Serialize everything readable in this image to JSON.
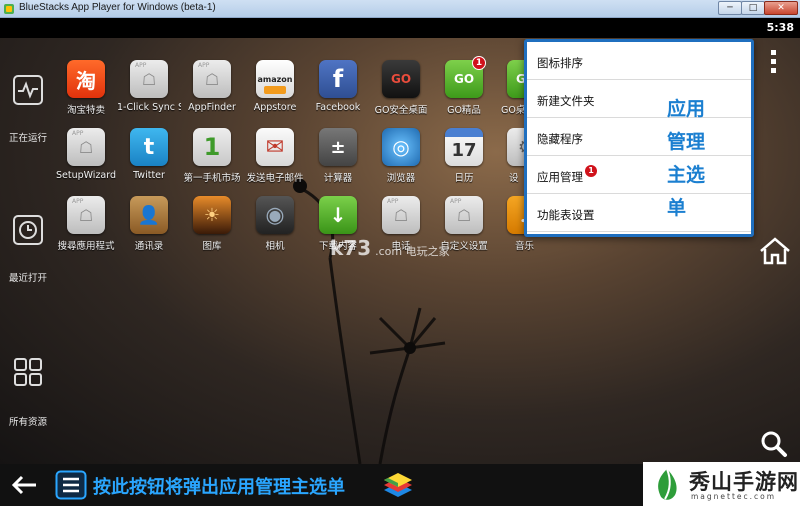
{
  "window": {
    "title": "BlueStacks App Player for Windows (beta-1)",
    "min_label": "─",
    "max_label": "□",
    "close_label": "✕"
  },
  "status": {
    "time": "5:38"
  },
  "rail": {
    "running_label": "正在运行",
    "recent_label": "最近打开",
    "all_label": "所有资源"
  },
  "apps": {
    "row1": [
      {
        "label": "淘宝特卖",
        "glyph": "淘"
      },
      {
        "label": "1-Click Sync S",
        "glyph": "APP"
      },
      {
        "label": "AppFinder",
        "glyph": "APP"
      },
      {
        "label": "Appstore",
        "glyph": "amazon"
      },
      {
        "label": "Facebook",
        "glyph": "f"
      },
      {
        "label": "GO安全桌面",
        "glyph": "GO"
      },
      {
        "label": "GO精品",
        "glyph": "GO",
        "badge": "1"
      },
      {
        "label": "GO桌面",
        "glyph": "GO",
        "badge": "1"
      }
    ],
    "row2": [
      {
        "label": "SetupWizard",
        "glyph": "APP"
      },
      {
        "label": "Twitter",
        "glyph": "t"
      },
      {
        "label": "第一手机市场",
        "glyph": "1"
      },
      {
        "label": "发送电子邮件",
        "glyph": "✉"
      },
      {
        "label": "计算器",
        "glyph": "±"
      },
      {
        "label": "浏览器",
        "glyph": "◎"
      },
      {
        "label": "日历",
        "glyph": "17"
      },
      {
        "label": "设",
        "glyph": "⚙"
      }
    ],
    "row3": [
      {
        "label": "搜尋應用程式",
        "glyph": "APP"
      },
      {
        "label": "通讯录",
        "glyph": "👤"
      },
      {
        "label": "图库",
        "glyph": "☀"
      },
      {
        "label": "相机",
        "glyph": "◉"
      },
      {
        "label": "下载内容",
        "glyph": "↓"
      },
      {
        "label": "电话",
        "glyph": "APP"
      },
      {
        "label": "自定义设置",
        "glyph": "APP"
      },
      {
        "label": "音乐",
        "glyph": "♪"
      }
    ]
  },
  "menu": {
    "items": [
      "图标排序",
      "新建文件夹",
      "隐藏程序",
      "应用管理",
      "功能表设置"
    ],
    "item_badge": "1",
    "note": [
      "应用",
      "管理",
      "主选",
      "单"
    ]
  },
  "watermark": {
    "main": "k73",
    "sub": ".com 电玩之家"
  },
  "bottom": {
    "hint": "按此按钮将弹出应用管理主选单"
  },
  "brand": {
    "title": "秀山手游网",
    "sub": "magnettec.com"
  },
  "colors": {
    "accent": "#1f6fbf",
    "hint_text": "#2aa6ff",
    "badge": "#d0121b"
  }
}
